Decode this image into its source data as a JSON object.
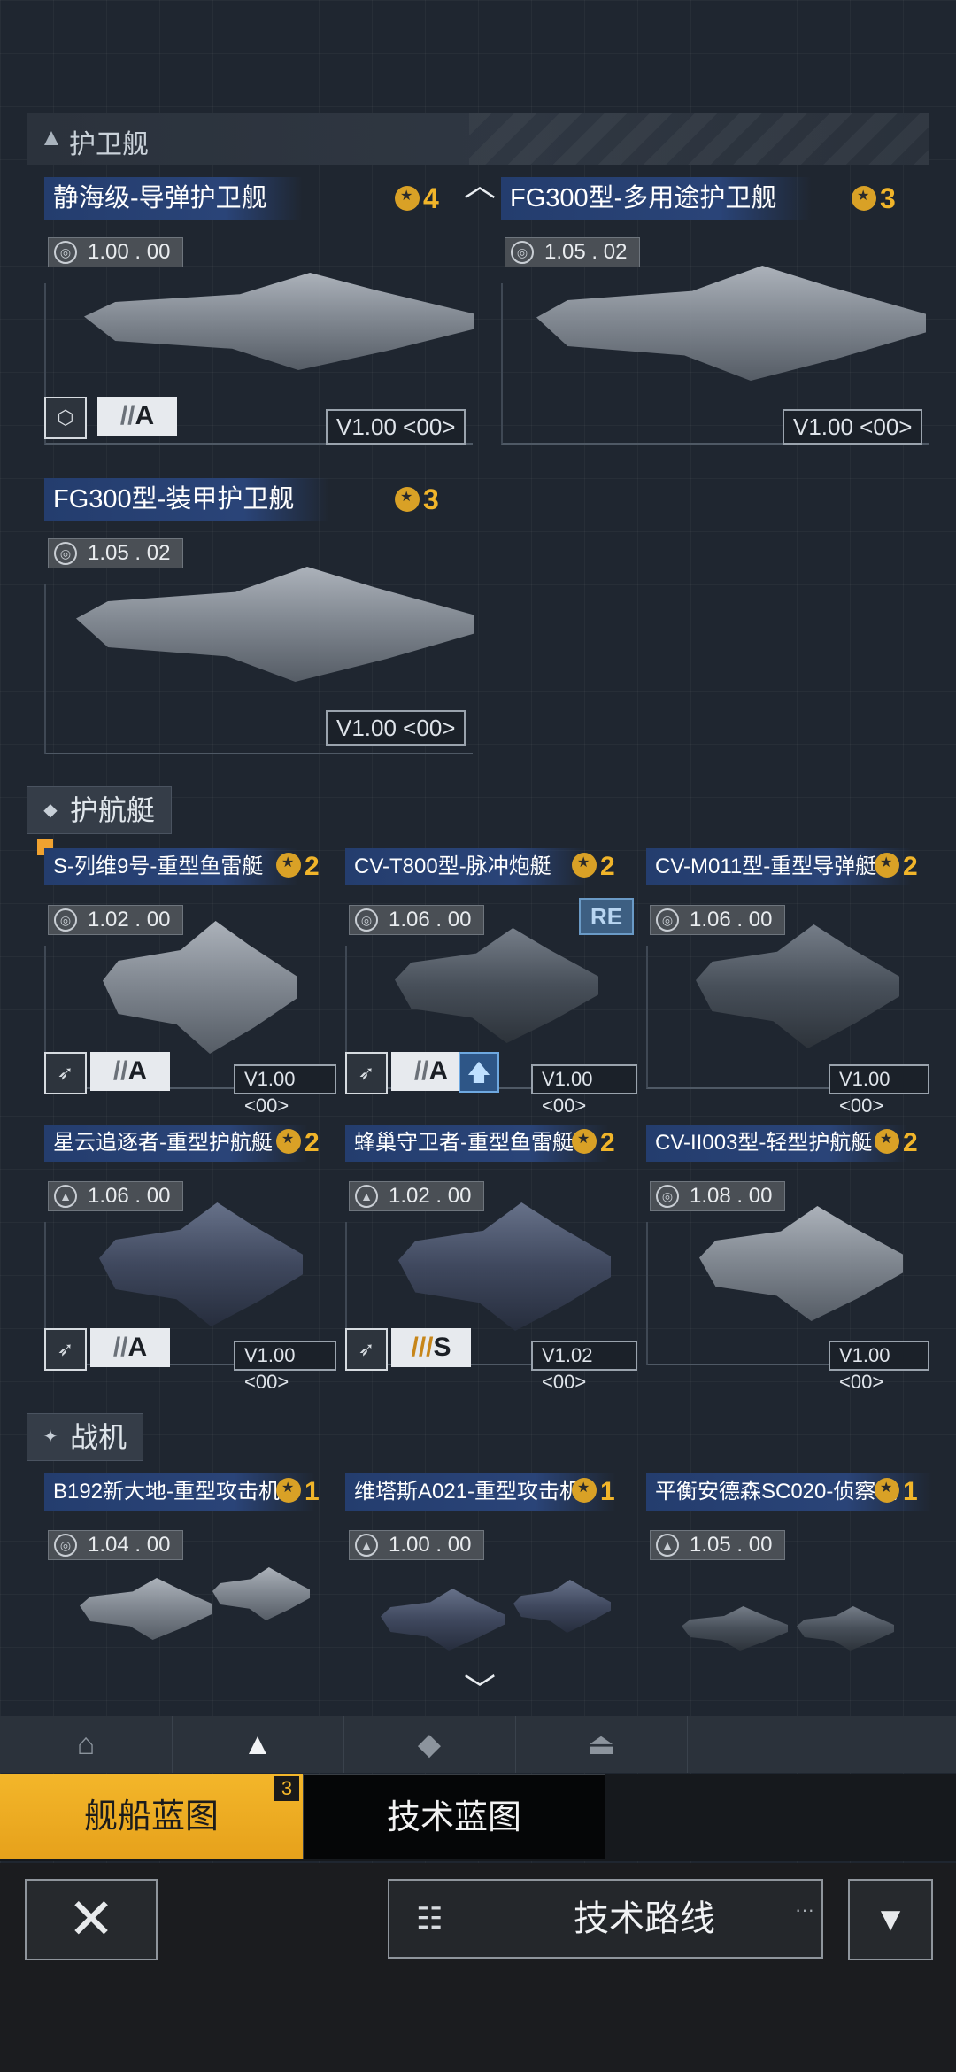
{
  "header": {
    "title": "护卫舰"
  },
  "frigates": [
    {
      "name": "静海级-导弹护卫舰",
      "rank": "4",
      "version": "1.00",
      "version_suffix": "00",
      "grade": "A",
      "vtag": "V1.00 <00>"
    },
    {
      "name": "FG300型-多用途护卫舰",
      "rank": "3",
      "version": "1.05",
      "version_suffix": "02",
      "vtag": "V1.00 <00>"
    },
    {
      "name": "FG300型-装甲护卫舰",
      "rank": "3",
      "version": "1.05",
      "version_suffix": "02",
      "vtag": "V1.00 <00>"
    }
  ],
  "escort_section": {
    "title": "护航艇"
  },
  "escorts": [
    {
      "name": "S-列维9号-重型鱼雷艇",
      "rank": "2",
      "version": "1.02",
      "version_suffix": "00",
      "grade": "A",
      "vtag": "V1.00 <00>"
    },
    {
      "name": "CV-T800型-脉冲炮艇",
      "rank": "2",
      "version": "1.06",
      "version_suffix": "00",
      "grade": "A",
      "vtag": "V1.00 <00>",
      "badge": "RE"
    },
    {
      "name": "CV-M011型-重型导弹艇",
      "rank": "2",
      "version": "1.06",
      "version_suffix": "00",
      "vtag": "V1.00 <00>"
    },
    {
      "name": "星云追逐者-重型护航艇",
      "rank": "2",
      "version": "1.06",
      "version_suffix": "00",
      "grade": "A",
      "vtag": "V1.00 <00>"
    },
    {
      "name": "蜂巢守卫者-重型鱼雷艇",
      "rank": "2",
      "version": "1.02",
      "version_suffix": "00",
      "grade": "S",
      "vtag": "V1.02 <00>"
    },
    {
      "name": "CV-II003型-轻型护航艇",
      "rank": "2",
      "version": "1.08",
      "version_suffix": "00",
      "vtag": "V1.00 <00>"
    }
  ],
  "fighter_section": {
    "title": "战机"
  },
  "fighters": [
    {
      "name": "B192新大地-重型攻击机",
      "rank": "1",
      "version": "1.04",
      "version_suffix": "00"
    },
    {
      "name": "维塔斯A021-重型攻击机",
      "rank": "1",
      "version": "1.00",
      "version_suffix": "00"
    },
    {
      "name": "平衡安德森SC020-侦察机",
      "rank": "1",
      "version": "1.05",
      "version_suffix": "00"
    }
  ],
  "tabs": {
    "ships": "舰船蓝图",
    "ships_count": "3",
    "tech": "技术蓝图"
  },
  "actions": {
    "tech_route": "技术路线",
    "close_glyph": "✕"
  }
}
